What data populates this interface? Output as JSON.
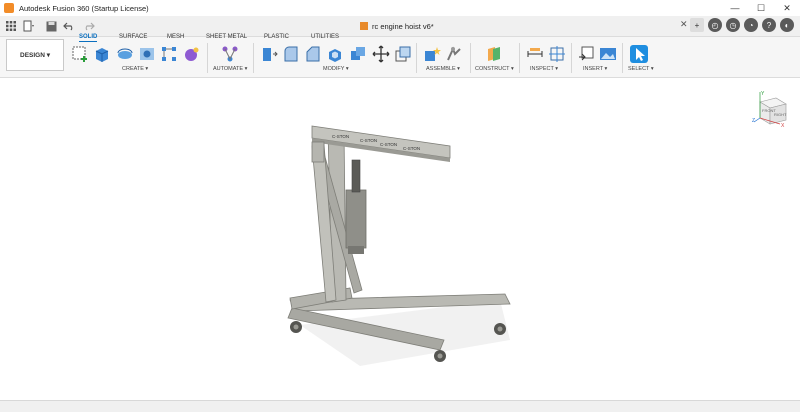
{
  "window": {
    "title": "Autodesk Fusion 360 (Startup License)",
    "minimize": "—",
    "maximize": "☐",
    "close": "✕"
  },
  "document": {
    "tab_title": "rc engine hoist v6*",
    "close_symbol": "✕"
  },
  "workspace": {
    "design_label": "DESIGN ▾"
  },
  "tabs": [
    "SOLID",
    "SURFACE",
    "MESH",
    "SHEET METAL",
    "PLASTIC",
    "UTILITIES"
  ],
  "groups": {
    "create": "CREATE ▾",
    "automate": "AUTOMATE ▾",
    "modify": "MODIFY ▾",
    "assemble": "ASSEMBLE ▾",
    "construct": "CONSTRUCT ▾",
    "inspect": "INSPECT ▾",
    "insert": "INSERT ▾",
    "select": "SELECT ▾"
  },
  "viewcube": {
    "face_label": "FRONT",
    "side_label": "RIGHT",
    "axis_x": "X",
    "axis_y": "Y",
    "axis_z": "Z"
  },
  "model": {
    "boom_labels": [
      "C-STON",
      "C-STON",
      "C-STON",
      "C-STON"
    ]
  },
  "colors": {
    "accent": "#0a6fbf",
    "model_gray": "#b9b9b3",
    "model_dark": "#8f8f89",
    "select_blue": "#1f8ee0"
  }
}
